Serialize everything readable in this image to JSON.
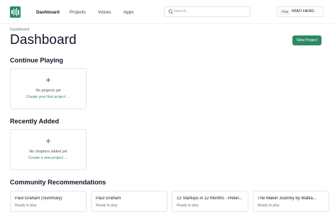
{
  "nav": {
    "items": [
      "Dashboard",
      "Projects",
      "Voices",
      "Apps"
    ],
    "active": "Dashboard"
  },
  "search": {
    "placeholder": "Search..."
  },
  "user": {
    "plan_badge": "Free",
    "name": "MIAO HENG"
  },
  "header": {
    "breadcrumb": "Dashboard",
    "title": "Dashboard",
    "new_project_label": "New Project"
  },
  "sections": {
    "continue_playing": {
      "title": "Continue Playing",
      "empty_message": "No projects yet",
      "action_label": "Create your first project →"
    },
    "recently_added": {
      "title": "Recently Added",
      "empty_message": "No chapters added yet",
      "action_label": "Create a new project →"
    },
    "community": {
      "title": "Community Recommendations",
      "cards": [
        {
          "title": "Paul Graham (Summary)",
          "status": "Ready to play"
        },
        {
          "title": "Paul Graham",
          "status": "Ready to play"
        },
        {
          "title": "12 Startups in 12 Months - Pieter...",
          "status": "Ready to play"
        },
        {
          "title": "The Maker Journey by Mattia...",
          "status": "Ready to play"
        }
      ]
    }
  },
  "colors": {
    "accent": "#2d8a63",
    "border": "#e5e7eb",
    "text": "#111827",
    "muted": "#6b7280"
  },
  "icons": {
    "logo": "audio-waveform-icon",
    "search": "search-icon",
    "plus": "plus-icon"
  }
}
